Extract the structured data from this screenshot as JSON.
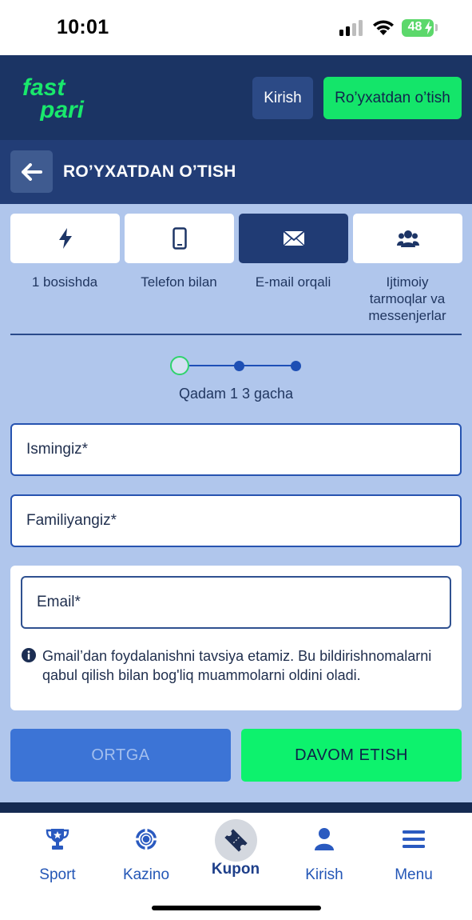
{
  "status_bar": {
    "time": "10:01",
    "battery": "48"
  },
  "header": {
    "logo_top": "fast",
    "logo_bottom": "pari",
    "login_label": "Kirish",
    "register_label": "Ro’yxatdan o’tish"
  },
  "title_bar": {
    "title": "RO’YXATDAN O’TISH",
    "back_icon": "arrow-left-icon"
  },
  "registration_methods": [
    {
      "label": "1 bosishda",
      "icon": "lightning-icon",
      "active": false
    },
    {
      "label": "Telefon bilan",
      "icon": "phone-icon",
      "active": false
    },
    {
      "label": "E-mail orqali",
      "icon": "envelope-icon",
      "active": true
    },
    {
      "label": "Ijtimoiy tarmoqlar va messenjerlar",
      "icon": "users-icon",
      "active": false
    }
  ],
  "stepper": {
    "current_step": 1,
    "total_steps": 3,
    "text": "Qadam 1 3 gacha"
  },
  "form": {
    "first_name_placeholder": "Ismingiz*",
    "last_name_placeholder": "Familiyangiz*",
    "email_placeholder": "Email*",
    "hint": "Gmail’dan foydalanishni tavsiya etamiz. Bu bildirishnomalarni qabul qilish bilan bog'liq muammolarni oldini oladi."
  },
  "actions": {
    "back_label": "ORTGA",
    "continue_label": "DAVOM ETISH"
  },
  "bottom_nav": [
    {
      "label": "Sport",
      "icon": "trophy-icon"
    },
    {
      "label": "Kazino",
      "icon": "casino-chip-icon"
    },
    {
      "label": "Kupon",
      "icon": "ticket-icon",
      "active": true
    },
    {
      "label": "Kirish",
      "icon": "user-icon"
    },
    {
      "label": "Menu",
      "icon": "menu-icon"
    }
  ],
  "colors": {
    "header_bg": "#1b3464",
    "content_bg": "#b0c6ec",
    "accent_green": "#14e56a",
    "nav_blue": "#2356b6"
  }
}
